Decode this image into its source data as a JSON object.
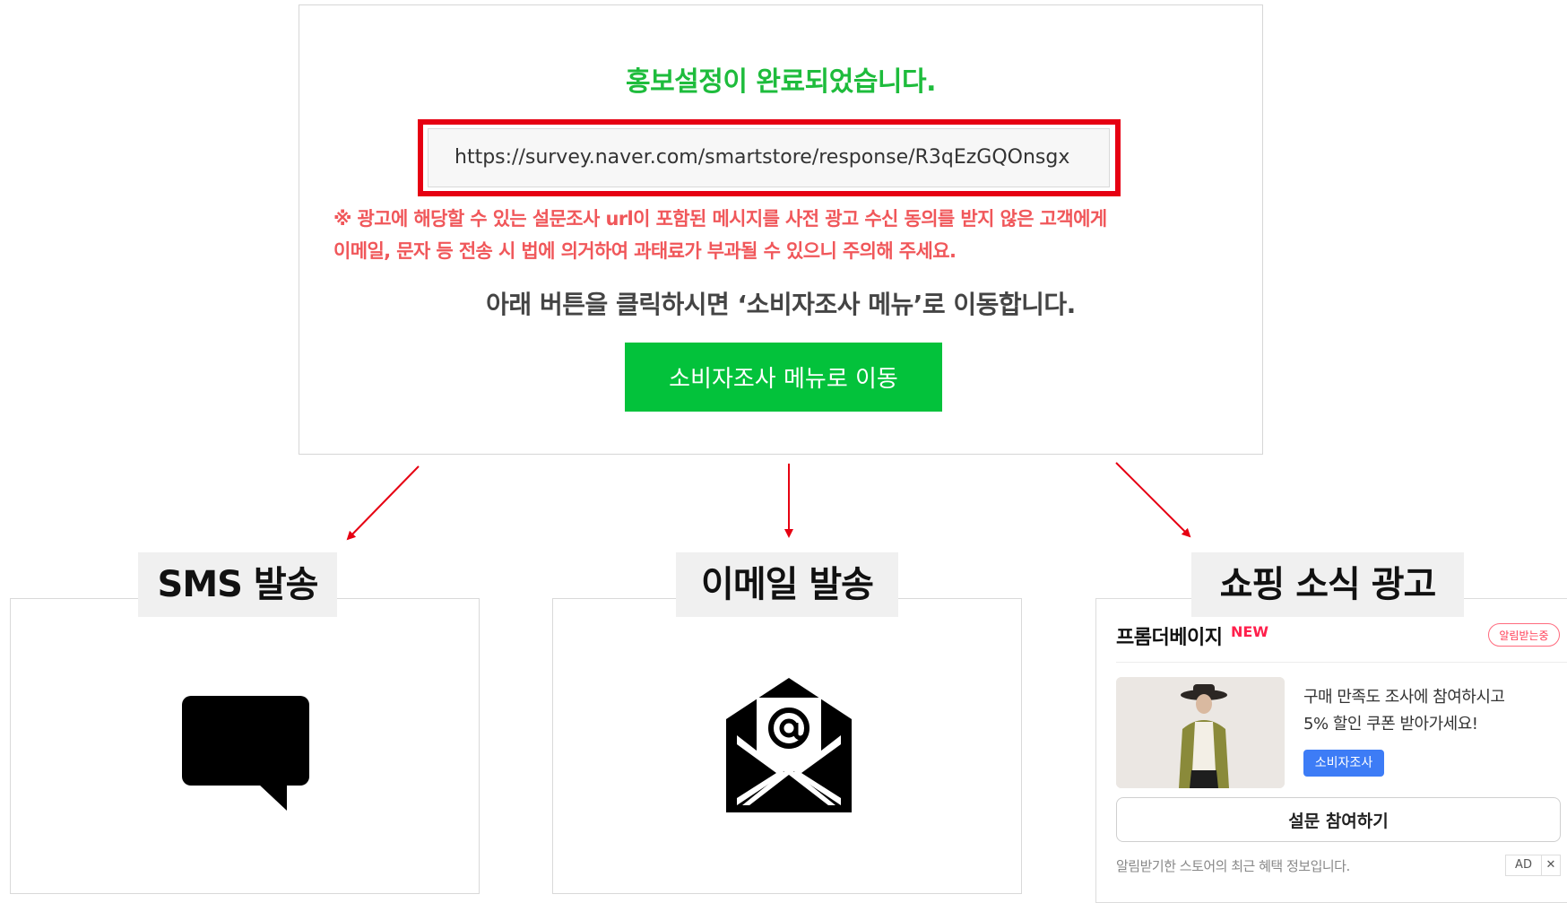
{
  "top_panel": {
    "title": "홍보설정이 완료되었습니다.",
    "survey_url": "https://survey.naver.com/smartstore/response/R3qEzGQOnsgx",
    "warning_line1": "※ 광고에 해당할 수 있는 설문조사 url이 포함된 메시지를 사전 광고 수신 동의를 받지 않은 고객에게",
    "warning_line2": "이메일, 문자 등 전송 시 법에 의거하여 과태료가 부과될 수 있으니 주의해 주세요.",
    "guide_text": "아래 버튼을 클릭하시면 ‘소비자조사 메뉴’로 이동합니다.",
    "button_label": "소비자조사 메뉴로 이동"
  },
  "sections": {
    "sms": {
      "label": "SMS 발송",
      "icon": "chat-bubble-icon"
    },
    "email": {
      "label": "이메일 발송",
      "icon": "envelope-at-icon"
    },
    "shopping": {
      "label": "쇼핑 소식 광고"
    }
  },
  "ad": {
    "store_name": "프롬더베이지",
    "new_badge": "NEW",
    "notify_badge": "알림받는중",
    "message_line1": "구매 만족도 조사에 참여하시고",
    "message_line2": "5% 할인 쿠폰 받아가세요!",
    "chip_label": "소비자조사",
    "join_button": "설문 참여하기",
    "footer_text": "알림받기한 스토어의 최근 혜택 정보입니다.",
    "ad_label": "AD",
    "close_label": "✕"
  },
  "colors": {
    "accent_green": "#03c23b",
    "title_green": "#1ebc3c",
    "highlight_red": "#e60012",
    "warning_red": "#f0575a",
    "chip_blue": "#3d7cf6"
  }
}
